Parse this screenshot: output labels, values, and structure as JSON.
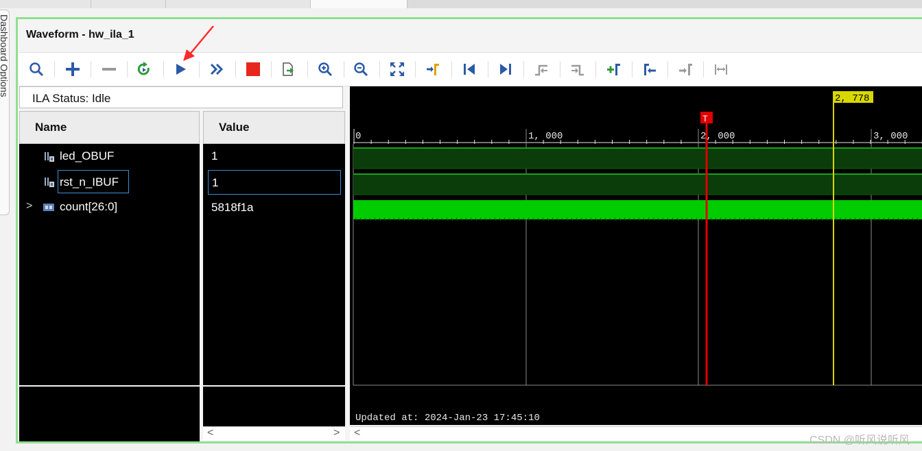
{
  "window": {
    "title": "Waveform - hw_ila_1",
    "side_tab_label": "Dashboard Options"
  },
  "toolbar": {
    "buttons": [
      {
        "name": "search-icon",
        "color": "#2b5aa6"
      },
      {
        "name": "add-icon",
        "color": "#2b5aa6"
      },
      {
        "name": "remove-icon",
        "color": "#9a9a9a"
      },
      {
        "name": "auto-retrigger-icon",
        "color": "#2e9a3b"
      },
      {
        "name": "run-trigger-icon",
        "color": "#2b5aa6"
      },
      {
        "name": "run-immediate-icon",
        "color": "#2b5aa6"
      },
      {
        "name": "stop-trigger-icon",
        "color": "#e8261c"
      },
      {
        "name": "export-icon",
        "color": "#2b5aa6"
      },
      {
        "name": "zoom-in-icon",
        "color": "#2b5aa6"
      },
      {
        "name": "zoom-out-icon",
        "color": "#2b5aa6"
      },
      {
        "name": "zoom-fit-icon",
        "color": "#2b5aa6"
      },
      {
        "name": "go-to-cursor-icon",
        "color": "#e0a000"
      },
      {
        "name": "go-to-start-icon",
        "color": "#2b5aa6"
      },
      {
        "name": "go-to-end-icon",
        "color": "#2b5aa6"
      },
      {
        "name": "previous-transition-icon",
        "color": "#9a9a9a"
      },
      {
        "name": "next-transition-icon",
        "color": "#9a9a9a"
      },
      {
        "name": "add-marker-icon",
        "color": "#2e9a3b"
      },
      {
        "name": "previous-marker-icon",
        "color": "#2b5aa6"
      },
      {
        "name": "next-marker-icon",
        "color": "#9a9a9a"
      },
      {
        "name": "swap-cursors-icon",
        "color": "#9a9a9a"
      }
    ]
  },
  "status": {
    "text": "ILA Status:  Idle"
  },
  "columns": {
    "name": "Name",
    "value": "Value"
  },
  "signals": [
    {
      "name": "led_OBUF",
      "value": "1",
      "type": "bit"
    },
    {
      "name": "rst_n_IBUF",
      "value": "1",
      "type": "bit",
      "selected": true
    },
    {
      "name": "count[26:0]",
      "value": "5818f1a",
      "type": "bus"
    }
  ],
  "timeline": {
    "ticks": [
      "0",
      "1, 000",
      "2, 000",
      "3, 000"
    ],
    "trigger_marker": {
      "label": "T",
      "position": 2000,
      "color": "#e00000"
    },
    "cursor": {
      "label": "2, 778",
      "position": 2778,
      "color": "#d8d800"
    }
  },
  "colors": {
    "wave_bit": "#0a3d0a",
    "wave_bit_edge": "#1a8a1a",
    "wave_bus": "#00cc00",
    "panel_border": "#8fe08f"
  },
  "footer": {
    "updated_at": "Updated at: 2024-Jan-23 17:45:10",
    "watermark": "CSDN @听风说听风"
  }
}
